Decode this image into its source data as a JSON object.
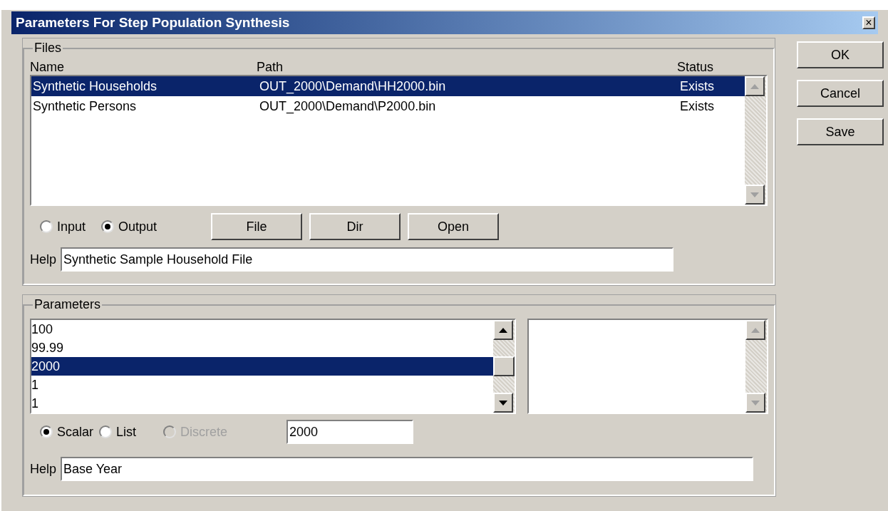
{
  "window": {
    "title": "Parameters For Step Population Synthesis",
    "close": "×"
  },
  "files": {
    "group_label": "Files",
    "columns": [
      "Name",
      "Path",
      "Status"
    ],
    "rows": [
      {
        "name": "Synthetic Households",
        "path": "OUT_2000\\Demand\\HH2000.bin",
        "status": "Exists",
        "selected": true
      },
      {
        "name": "Synthetic Persons",
        "path": "OUT_2000\\Demand\\P2000.bin",
        "status": "Exists",
        "selected": false
      }
    ],
    "io_options": [
      {
        "label": "Input",
        "selected": false
      },
      {
        "label": "Output",
        "selected": true
      }
    ],
    "buttons": [
      "File",
      "Dir",
      "Open"
    ],
    "help_label": "Help",
    "help_value": "Synthetic Sample Household File"
  },
  "parameters": {
    "group_label": "Parameters",
    "values": [
      {
        "text": "100",
        "selected": false
      },
      {
        "text": "99.99",
        "selected": false
      },
      {
        "text": "2000",
        "selected": true
      },
      {
        "text": "1",
        "selected": false
      },
      {
        "text": "1",
        "selected": false
      }
    ],
    "modes": [
      {
        "label": "Scalar",
        "selected": true,
        "disabled": false
      },
      {
        "label": "List",
        "selected": false,
        "disabled": false
      },
      {
        "label": "Discrete",
        "selected": false,
        "disabled": true
      }
    ],
    "value": "2000",
    "help_label": "Help",
    "help_value": "Base Year"
  },
  "dialog_buttons": [
    "OK",
    "Cancel",
    "Save"
  ]
}
